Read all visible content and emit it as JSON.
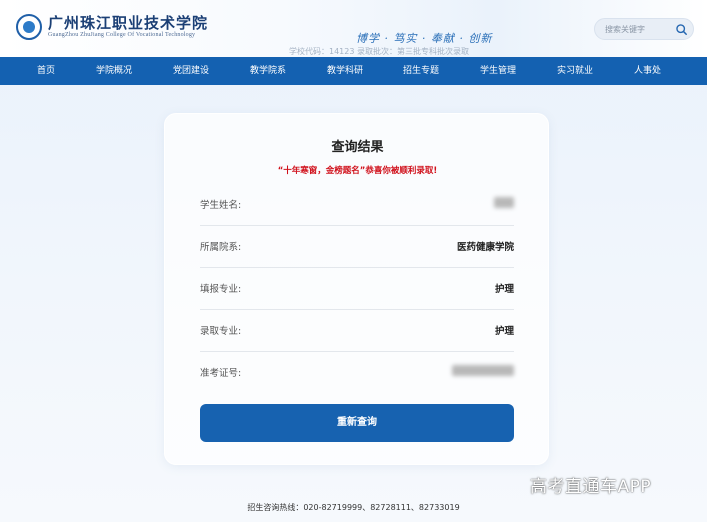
{
  "header": {
    "school_name": "广州珠江职业技术学院",
    "school_name_en": "GuangZhou ZhuJiang College Of Vocational Technology",
    "motto": "博学 · 笃实 · 奉献 · 创新",
    "admission_info": "学校代码：14123   录取批次：第三批专科批次录取",
    "search": {
      "placeholder": "搜索关键字",
      "icon": "search-icon"
    }
  },
  "nav": {
    "items": [
      {
        "label": "首页"
      },
      {
        "label": "学院概况"
      },
      {
        "label": "党团建设"
      },
      {
        "label": "教学院系"
      },
      {
        "label": "教学科研"
      },
      {
        "label": "招生专题"
      },
      {
        "label": "学生管理"
      },
      {
        "label": "实习就业"
      },
      {
        "label": "人事处"
      }
    ],
    "background_color": "#1461b1"
  },
  "result": {
    "title": "查询结果",
    "congrats": "“十年寒窗，金榜题名”恭喜你被顺利录取!",
    "rows": [
      {
        "label": "学生姓名:",
        "value": "",
        "redacted": true
      },
      {
        "label": "所属院系:",
        "value": "医药健康学院"
      },
      {
        "label": "填报专业:",
        "value": "护理"
      },
      {
        "label": "录取专业:",
        "value": "护理"
      },
      {
        "label": "准考证号:",
        "value": "",
        "redacted": true
      }
    ],
    "requery_button": "重新查询",
    "accent_color": "#1762b0",
    "highlight_color": "#d0101b"
  },
  "footer": {
    "hotline": "招生咨询热线：020-82719999、82728111、82733019"
  },
  "watermark": "高考直通车APP"
}
